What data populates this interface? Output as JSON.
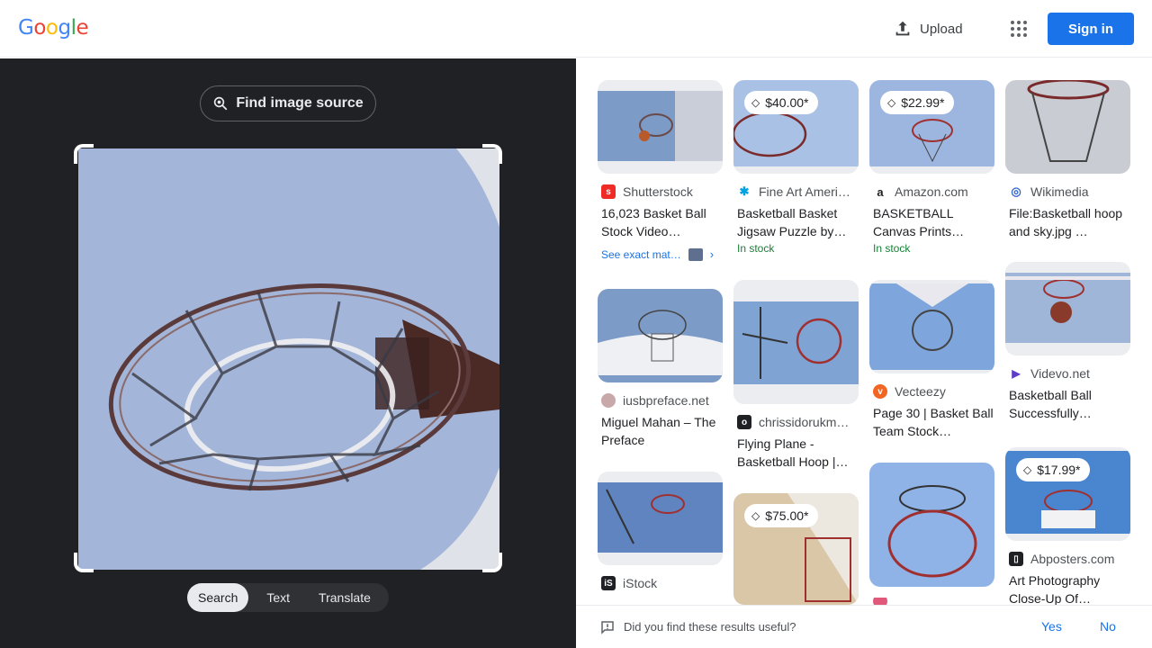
{
  "header": {
    "logo_letters": [
      "G",
      "o",
      "o",
      "g",
      "l",
      "e"
    ],
    "logo_colors": [
      "#4285f4",
      "#ea4335",
      "#fbbc05",
      "#4285f4",
      "#34a853",
      "#ea4335"
    ],
    "upload_label": "Upload",
    "signin_label": "Sign in",
    "accent": "#1a73e8"
  },
  "left_panel": {
    "find_source_label": "Find image source",
    "modes": [
      {
        "label": "Search",
        "active": true
      },
      {
        "label": "Text",
        "active": false
      },
      {
        "label": "Translate",
        "active": false
      }
    ]
  },
  "results": [
    {
      "source": "Shutterstock",
      "favicon": "shutterstock-icon",
      "fav_color": "#ee2b24",
      "title": "16,023 Basket Ball Stock Video…",
      "extra": "See exact mat…",
      "price": "",
      "stock": ""
    },
    {
      "source": "Fine Art Ameri…",
      "favicon": "fineartamerica-icon",
      "fav_color": "#00a3e0",
      "title": "Basketball Basket Jigsaw Puzzle by…",
      "price": "$40.00*",
      "stock": "In stock",
      "extra": ""
    },
    {
      "source": "Amazon.com",
      "favicon": "amazon-icon",
      "fav_color": "#ffffff",
      "title": "BASKETBALL Canvas Prints…",
      "price": "$22.99*",
      "stock": "In stock",
      "extra": ""
    },
    {
      "source": "Wikimedia",
      "favicon": "wikimedia-icon",
      "fav_color": "#ffffff",
      "title": "File:Basketball hoop and sky.jpg …",
      "price": "",
      "stock": "",
      "extra": ""
    },
    {
      "source": "iusbpreface.net",
      "favicon": "iusbpreface-icon",
      "fav_color": "#c8a8a8",
      "title": "Miguel Mahan – The Preface",
      "price": "",
      "stock": "",
      "extra": ""
    },
    {
      "source": "chrissidorukm…",
      "favicon": "chrissidorukm-icon",
      "fav_color": "#202124",
      "title": "Flying Plane - Basketball Hoop |…",
      "price": "",
      "stock": "",
      "extra": ""
    },
    {
      "source": "Vecteezy",
      "favicon": "vecteezy-icon",
      "fav_color": "#f26522",
      "title": "Page 30 | Basket Ball Team Stock…",
      "price": "",
      "stock": "",
      "extra": ""
    },
    {
      "source": "Videvo.net",
      "favicon": "videvo-icon",
      "fav_color": "#ffffff",
      "title": "Basketball Ball Successfully…",
      "price": "",
      "stock": "",
      "extra": ""
    },
    {
      "source": "iStock",
      "favicon": "istock-icon",
      "fav_color": "#202124",
      "title": "",
      "price": "",
      "stock": "",
      "extra": ""
    },
    {
      "source": "",
      "favicon": "",
      "fav_color": "",
      "title": "",
      "price": "$75.00*",
      "stock": "",
      "extra": ""
    },
    {
      "source": "",
      "favicon": "",
      "fav_color": "",
      "title": "",
      "price": "",
      "stock": "",
      "extra": ""
    },
    {
      "source": "Abposters.com",
      "favicon": "abposters-icon",
      "fav_color": "#202124",
      "title": "Art Photography Close-Up Of…",
      "price": "$17.99*",
      "stock": "",
      "extra": ""
    }
  ],
  "feedback": {
    "question": "Did you find these results useful?",
    "yes_label": "Yes",
    "no_label": "No"
  }
}
